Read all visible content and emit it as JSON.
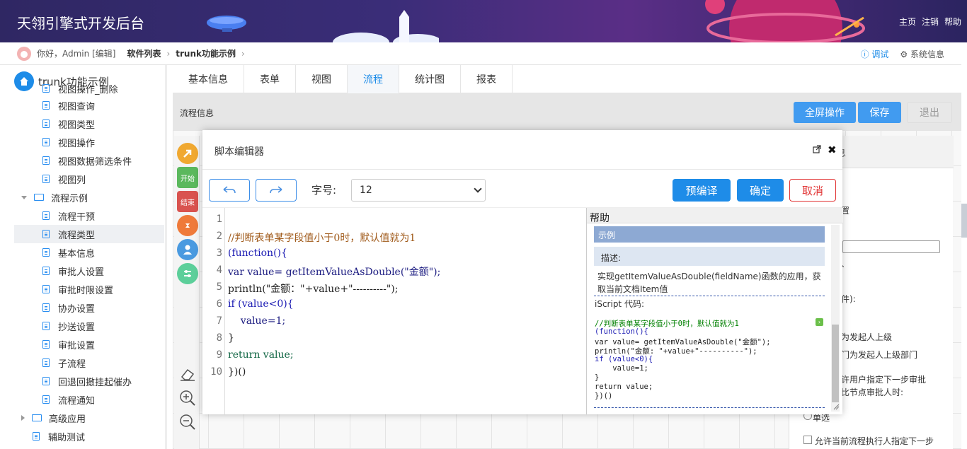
{
  "header": {
    "app_title": "天翎引擎式开发后台",
    "links": [
      "主页",
      "注销",
      "帮助"
    ]
  },
  "breadcrumb": {
    "greeting": "你好，Admin [编辑]",
    "items": [
      "软件列表",
      "trunk功能示例"
    ],
    "debug_label": "调试",
    "sysinfo_label": "系统信息"
  },
  "sidebar": {
    "root_label": "trunk功能示例",
    "items": [
      {
        "label": "视图操作_删除",
        "type": "file",
        "level": 2
      },
      {
        "label": "视图查询",
        "type": "file",
        "level": 2
      },
      {
        "label": "视图类型",
        "type": "file",
        "level": 2
      },
      {
        "label": "视图操作",
        "type": "file",
        "level": 2
      },
      {
        "label": "视图数据筛选条件",
        "type": "file",
        "level": 2
      },
      {
        "label": "视图列",
        "type": "file",
        "level": 2
      },
      {
        "label": "流程示例",
        "type": "folder-open",
        "level": 1
      },
      {
        "label": "流程干预",
        "type": "file",
        "level": 2
      },
      {
        "label": "流程类型",
        "type": "file",
        "level": 2,
        "selected": true
      },
      {
        "label": "基本信息",
        "type": "file",
        "level": 2
      },
      {
        "label": "审批人设置",
        "type": "file",
        "level": 2
      },
      {
        "label": "审批时限设置",
        "type": "file",
        "level": 2
      },
      {
        "label": "协办设置",
        "type": "file",
        "level": 2
      },
      {
        "label": "抄送设置",
        "type": "file",
        "level": 2
      },
      {
        "label": "审批设置",
        "type": "file",
        "level": 2
      },
      {
        "label": "子流程",
        "type": "file",
        "level": 2
      },
      {
        "label": "回退回撤挂起催办",
        "type": "file",
        "level": 2
      },
      {
        "label": "流程通知",
        "type": "file",
        "level": 2
      },
      {
        "label": "高级应用",
        "type": "folder-closed",
        "level": 1
      },
      {
        "label": "辅助测试",
        "type": "file",
        "level": 1
      }
    ]
  },
  "tabs": [
    {
      "label": "基本信息"
    },
    {
      "label": "表单"
    },
    {
      "label": "视图"
    },
    {
      "label": "流程",
      "active": true
    },
    {
      "label": "统计图"
    },
    {
      "label": "报表"
    }
  ],
  "flow": {
    "title": "流程信息",
    "fullscreen_label": "全屏操作",
    "save_label": "保存",
    "exit_label": "退出"
  },
  "tools": {
    "start_label": "开始",
    "end_label": "结束"
  },
  "right_panel": {
    "title_fragment": "息",
    "texts": [
      "置",
      "、",
      "件):",
      "为发起人上级",
      "门为发起人上级部门",
      "许用户指定下一步审批",
      "比节点审批人时:",
      "单选",
      "允许当前流程执行人指定下一步"
    ]
  },
  "modal": {
    "title": "脚本编辑器",
    "font_label": "字号:",
    "font_value": "12",
    "precompile_label": "预编译",
    "ok_label": "确定",
    "cancel_label": "取消",
    "line_numbers": [
      "1",
      "2",
      "3",
      "4",
      "5",
      "6",
      "7",
      "8",
      "9",
      "10"
    ],
    "code_lines": [
      "",
      "//判断表单某字段值小于0时，默认值就为1",
      "(function(){",
      "var value= getItemValueAsDouble(\"金额\");",
      "println(\"金额：\"+value+\"----------\");",
      "if (value<0){",
      "    value=1;",
      "}",
      "return value;",
      "})()"
    ]
  },
  "help": {
    "title": "帮助",
    "section_label": "示例",
    "desc_label": "描述:",
    "description": "实现getItemValueAsDouble(fieldName)函数的应用，获取当前文档Item值",
    "iscript_label": "iScript 代码:",
    "code_lines": [
      "//判断表单某字段值小于0时，默认值就为1",
      "(function(){",
      "var value= getItemValueAsDouble(\"金额\");",
      "println(\"金额: \"+value+\"----------\");",
      "if (value<0){",
      "    value=1;",
      "}",
      "return value;",
      "})()"
    ]
  },
  "colors": {
    "accent": "#1e8ce8",
    "header_bg": "#2f2763",
    "cancel_red": "#e13333",
    "help_section": "#8da9d3"
  }
}
